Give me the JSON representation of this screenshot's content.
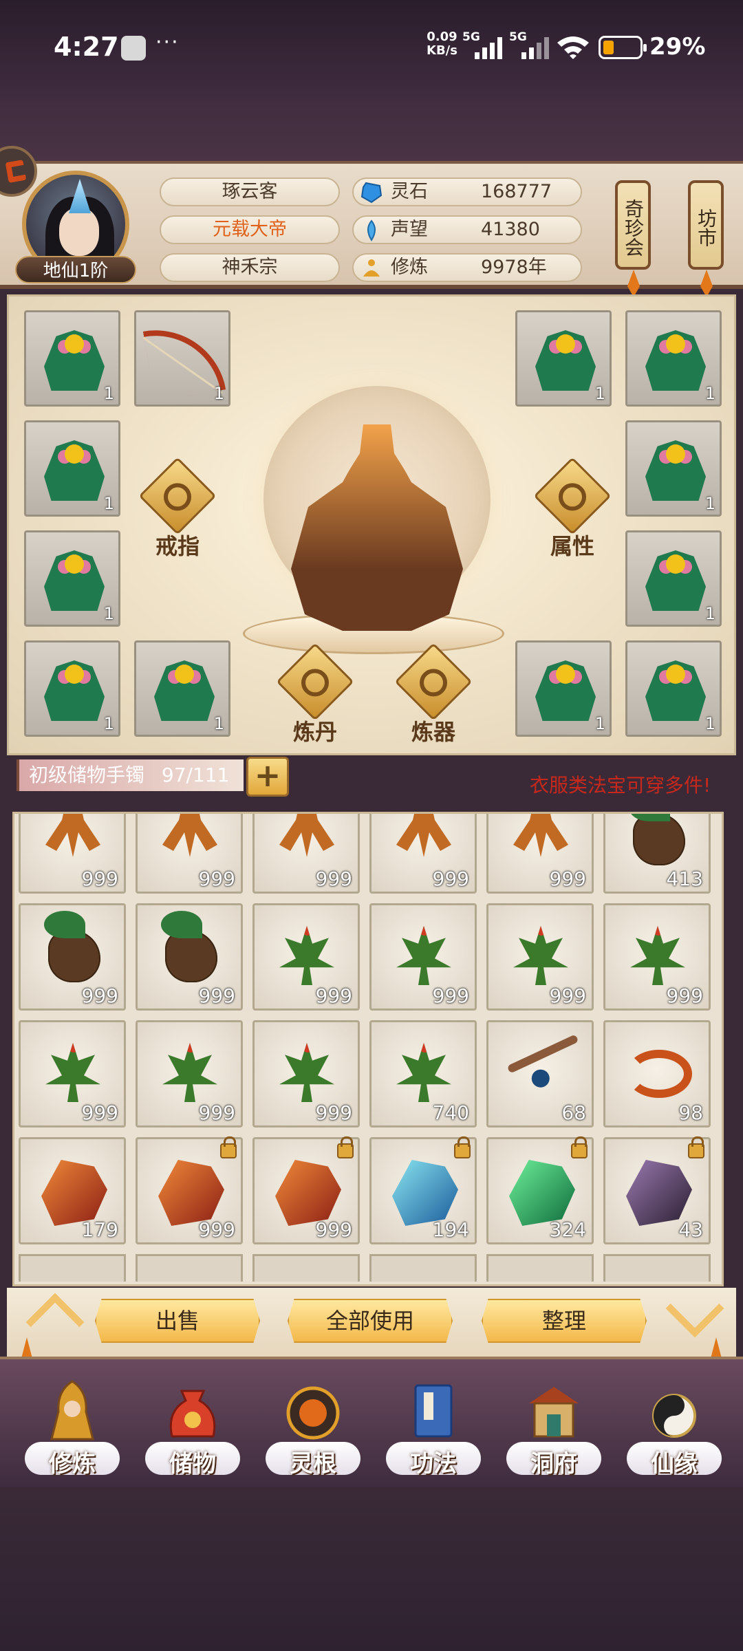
{
  "status_bar": {
    "time": "4:27",
    "net_speed_value": "0.09",
    "net_speed_unit": "KB/s",
    "sim1_label": "5G",
    "sim2_label": "5G",
    "battery_percent": "29%",
    "battery_level": 0.29
  },
  "header": {
    "rank_badge": "地仙1阶",
    "name_pills": [
      "琢云客",
      "元载大帝",
      "神禾宗"
    ],
    "resources": [
      {
        "icon": "spirit-stone-icon",
        "label": "灵石",
        "value": "168777"
      },
      {
        "icon": "reputation-icon",
        "label": "声望",
        "value": "41380"
      },
      {
        "icon": "cultivation-icon",
        "label": "修炼",
        "value": "9978年"
      }
    ],
    "lanterns": [
      "奇珍会",
      "坊市"
    ]
  },
  "equipment": {
    "slot_counts": [
      "1",
      "1",
      "1",
      "1",
      "1",
      "1",
      "1",
      "1",
      "1",
      "1",
      "1",
      "1"
    ],
    "buttons": {
      "ring": "戒指",
      "attributes": "属性",
      "alchemy": "炼丹",
      "forging": "炼器"
    }
  },
  "storage": {
    "title": "初级储物手镯",
    "capacity": "97/111",
    "plus": "+",
    "hint": "衣服类法宝可穿多件!",
    "items": [
      {
        "type": "root",
        "count": "999",
        "locked": false
      },
      {
        "type": "root",
        "count": "999",
        "locked": false
      },
      {
        "type": "root",
        "count": "999",
        "locked": false
      },
      {
        "type": "root",
        "count": "999",
        "locked": false
      },
      {
        "type": "root",
        "count": "999",
        "locked": false
      },
      {
        "type": "radish",
        "count": "413",
        "locked": false
      },
      {
        "type": "radish",
        "count": "999",
        "locked": false
      },
      {
        "type": "radish",
        "count": "999",
        "locked": false
      },
      {
        "type": "herb",
        "count": "999",
        "locked": false
      },
      {
        "type": "herb",
        "count": "999",
        "locked": false
      },
      {
        "type": "herb",
        "count": "999",
        "locked": false
      },
      {
        "type": "herb",
        "count": "999",
        "locked": false
      },
      {
        "type": "herb",
        "count": "999",
        "locked": false
      },
      {
        "type": "herb",
        "count": "999",
        "locked": false
      },
      {
        "type": "herb",
        "count": "999",
        "locked": false
      },
      {
        "type": "herb",
        "count": "740",
        "locked": false
      },
      {
        "type": "branch",
        "count": "68",
        "locked": false
      },
      {
        "type": "cord",
        "count": "98",
        "locked": false
      },
      {
        "type": "ore-red",
        "count": "179",
        "locked": false
      },
      {
        "type": "ore-red",
        "count": "999",
        "locked": true
      },
      {
        "type": "ore-red",
        "count": "999",
        "locked": true
      },
      {
        "type": "ore-blue",
        "count": "194",
        "locked": true
      },
      {
        "type": "ore-green",
        "count": "324",
        "locked": true
      },
      {
        "type": "ore-dark",
        "count": "43",
        "locked": true
      }
    ]
  },
  "actions": {
    "sell": "出售",
    "use_all": "全部使用",
    "organize": "整理"
  },
  "nav": [
    {
      "label": "修炼",
      "icon": "cultivate-icon"
    },
    {
      "label": "储物",
      "icon": "storage-bag-icon"
    },
    {
      "label": "灵根",
      "icon": "spirit-root-icon"
    },
    {
      "label": "功法",
      "icon": "technique-book-icon"
    },
    {
      "label": "洞府",
      "icon": "cave-dwelling-icon"
    },
    {
      "label": "仙缘",
      "icon": "immortal-fate-icon"
    }
  ],
  "colors": {
    "accent_orange": "#e0621a",
    "hint_red": "#c8281c",
    "button_gold": "#f3b84a"
  }
}
